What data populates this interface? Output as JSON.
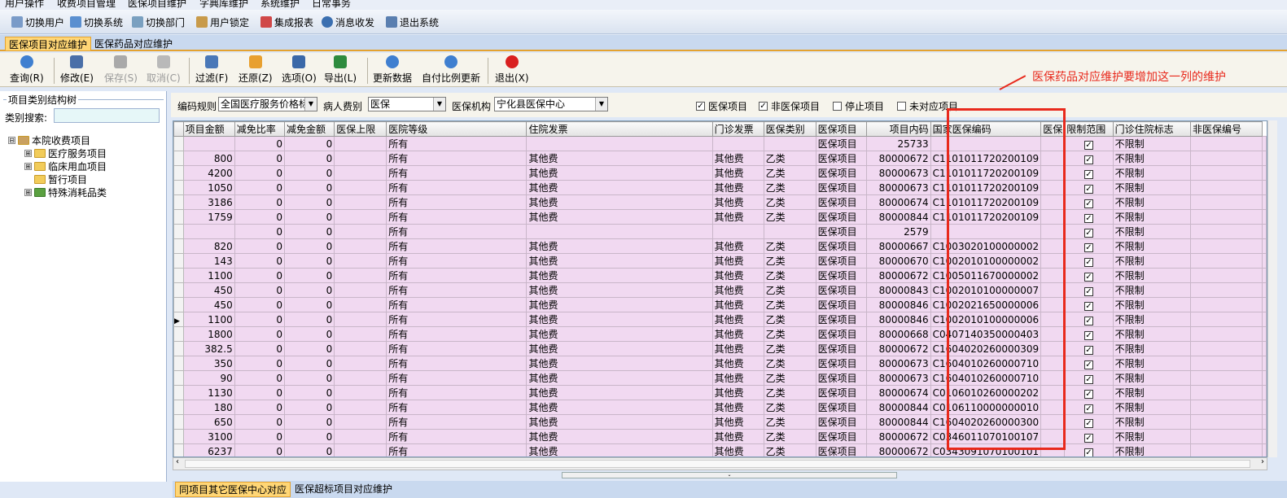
{
  "menu": [
    "用户操作",
    "收费项目管理",
    "医保项目维护",
    "字典库维护",
    "系统维护",
    "日常事务"
  ],
  "toolbar1": [
    "切换用户",
    "切换系统",
    "切换部门",
    "用户锁定",
    "集成报表",
    "消息收发",
    "退出系统"
  ],
  "top_tabs": [
    "医保项目对应维护",
    "医保药品对应维护"
  ],
  "toolbar2": [
    {
      "label": "查询(R)",
      "disabled": false
    },
    {
      "label": "修改(E)",
      "disabled": false
    },
    {
      "label": "保存(S)",
      "disabled": true
    },
    {
      "label": "取消(C)",
      "disabled": true
    },
    {
      "label": "过滤(F)",
      "disabled": false
    },
    {
      "label": "还原(Z)",
      "disabled": false
    },
    {
      "label": "选项(O)",
      "disabled": false
    },
    {
      "label": "导出(L)",
      "disabled": false
    },
    {
      "label": "更新数据",
      "disabled": false
    },
    {
      "label": "自付比例更新",
      "disabled": false
    },
    {
      "label": "退出(X)",
      "disabled": false
    }
  ],
  "annotation": "医保药品对应维护要增加这一列的维护",
  "left_panel": {
    "title": "项目类别结构树",
    "search_label": "类别搜索:",
    "search_value": "",
    "tree": [
      {
        "label": "本院收费项目",
        "level": 0,
        "expander": "⊟"
      },
      {
        "label": "医疗服务项目",
        "level": 1,
        "expander": "⊞"
      },
      {
        "label": "临床用血项目",
        "level": 1,
        "expander": "⊞"
      },
      {
        "label": "暂行项目",
        "level": 1,
        "expander": ""
      },
      {
        "label": "特殊消耗品类",
        "level": 1,
        "expander": "⊞"
      }
    ]
  },
  "filters": {
    "code_rule_label": "编码规则",
    "code_rule_value": "全国医疗服务价格标",
    "patient_type_label": "病人费别",
    "patient_type_value": "医保",
    "institution_label": "医保机构",
    "institution_value": "宁化县医保中心",
    "checks": [
      {
        "label": "医保项目",
        "checked": true
      },
      {
        "label": "非医保项目",
        "checked": true
      },
      {
        "label": "停止项目",
        "checked": false
      },
      {
        "label": "未对应项目",
        "checked": false
      }
    ]
  },
  "grid": {
    "columns": [
      "项目金额",
      "减免比率",
      "减免金额",
      "医保上限",
      "医院等级",
      "住院发票",
      "门诊发票",
      "医保类别",
      "医保项目",
      "项目内码",
      "国家医保编码",
      "医保",
      "限制范围",
      "门诊住院标志",
      "非医保编号"
    ],
    "rows": [
      [
        "",
        "0",
        "0",
        "",
        "所有",
        "",
        "",
        "",
        "医保项目",
        "25733",
        "",
        "",
        true,
        "不限制",
        ""
      ],
      [
        "800",
        "0",
        "0",
        "",
        "所有",
        "其他费",
        "其他费",
        "乙类",
        "医保项目",
        "80000672",
        "C1101011720200109",
        "",
        true,
        "不限制",
        ""
      ],
      [
        "4200",
        "0",
        "0",
        "",
        "所有",
        "其他费",
        "其他费",
        "乙类",
        "医保项目",
        "80000673",
        "C1101011720200109",
        "",
        true,
        "不限制",
        ""
      ],
      [
        "1050",
        "0",
        "0",
        "",
        "所有",
        "其他费",
        "其他费",
        "乙类",
        "医保项目",
        "80000673",
        "C1101011720200109",
        "",
        true,
        "不限制",
        ""
      ],
      [
        "3186",
        "0",
        "0",
        "",
        "所有",
        "其他费",
        "其他费",
        "乙类",
        "医保项目",
        "80000674",
        "C1101011720200109",
        "",
        true,
        "不限制",
        ""
      ],
      [
        "1759",
        "0",
        "0",
        "",
        "所有",
        "其他费",
        "其他费",
        "乙类",
        "医保项目",
        "80000844",
        "C1101011720200109",
        "",
        true,
        "不限制",
        ""
      ],
      [
        "",
        "0",
        "0",
        "",
        "所有",
        "",
        "",
        "",
        "医保项目",
        "2579",
        "",
        "",
        true,
        "不限制",
        ""
      ],
      [
        "820",
        "0",
        "0",
        "",
        "所有",
        "其他费",
        "其他费",
        "乙类",
        "医保项目",
        "80000667",
        "C1003020100000002",
        "",
        true,
        "不限制",
        ""
      ],
      [
        "143",
        "0",
        "0",
        "",
        "所有",
        "其他费",
        "其他费",
        "乙类",
        "医保项目",
        "80000670",
        "C1002010100000002",
        "",
        true,
        "不限制",
        ""
      ],
      [
        "1100",
        "0",
        "0",
        "",
        "所有",
        "其他费",
        "其他费",
        "乙类",
        "医保项目",
        "80000672",
        "C1005011670000002",
        "",
        true,
        "不限制",
        ""
      ],
      [
        "450",
        "0",
        "0",
        "",
        "所有",
        "其他费",
        "其他费",
        "乙类",
        "医保项目",
        "80000843",
        "C1002010100000007",
        "",
        true,
        "不限制",
        ""
      ],
      [
        "450",
        "0",
        "0",
        "",
        "所有",
        "其他费",
        "其他费",
        "乙类",
        "医保项目",
        "80000846",
        "C1002021650000006",
        "",
        true,
        "不限制",
        ""
      ],
      [
        "1100",
        "0",
        "0",
        "",
        "所有",
        "其他费",
        "其他费",
        "乙类",
        "医保项目",
        "80000846",
        "C1002010100000006",
        "",
        true,
        "不限制",
        ""
      ],
      [
        "1800",
        "0",
        "0",
        "",
        "所有",
        "其他费",
        "其他费",
        "乙类",
        "医保项目",
        "80000668",
        "C0407140350000403",
        "",
        true,
        "不限制",
        ""
      ],
      [
        "382.5",
        "0",
        "0",
        "",
        "所有",
        "其他费",
        "其他费",
        "乙类",
        "医保项目",
        "80000672",
        "C1604020260000309",
        "",
        true,
        "不限制",
        ""
      ],
      [
        "350",
        "0",
        "0",
        "",
        "所有",
        "其他费",
        "其他费",
        "乙类",
        "医保项目",
        "80000673",
        "C1604010260000710",
        "",
        true,
        "不限制",
        ""
      ],
      [
        "90",
        "0",
        "0",
        "",
        "所有",
        "其他费",
        "其他费",
        "乙类",
        "医保项目",
        "80000673",
        "C1604010260000710",
        "",
        true,
        "不限制",
        ""
      ],
      [
        "1130",
        "0",
        "0",
        "",
        "所有",
        "其他费",
        "其他费",
        "乙类",
        "医保项目",
        "80000674",
        "C0106010260000202",
        "",
        true,
        "不限制",
        ""
      ],
      [
        "180",
        "0",
        "0",
        "",
        "所有",
        "其他费",
        "其他费",
        "乙类",
        "医保项目",
        "80000844",
        "C0106110000000010",
        "",
        true,
        "不限制",
        ""
      ],
      [
        "650",
        "0",
        "0",
        "",
        "所有",
        "其他费",
        "其他费",
        "乙类",
        "医保项目",
        "80000844",
        "C1604020260000300",
        "",
        true,
        "不限制",
        ""
      ],
      [
        "3100",
        "0",
        "0",
        "",
        "所有",
        "其他费",
        "其他费",
        "乙类",
        "医保项目",
        "80000672",
        "C0346011070100107",
        "",
        true,
        "不限制",
        ""
      ],
      [
        "6237",
        "0",
        "0",
        "",
        "所有",
        "其他费",
        "其他费",
        "乙类",
        "医保项目",
        "80000672",
        "C0343091070100101",
        "",
        true,
        "不限制",
        ""
      ]
    ],
    "current_row": 12
  },
  "bottom_tabs": [
    "同项目其它医保中心对应",
    "医保超标项目对应维护"
  ],
  "colors": {
    "row_bg": "#f1d9f1",
    "annotation": "#e8291c",
    "active_tab": "#ffd675"
  }
}
